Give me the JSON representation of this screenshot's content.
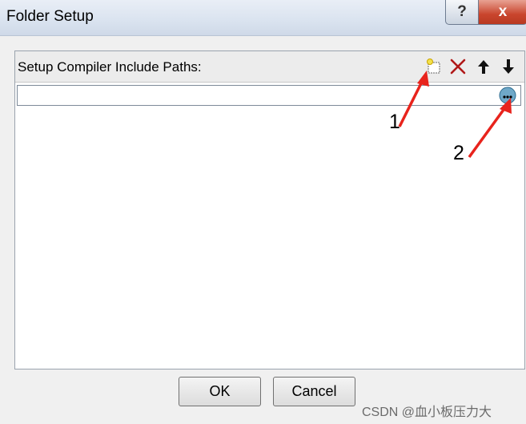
{
  "window": {
    "title": "Folder Setup",
    "help_label": "?",
    "close_label": "x"
  },
  "panel": {
    "label": "Setup Compiler Include Paths:",
    "toolbar": {
      "new_icon": "new-folder-icon",
      "delete_icon": "delete-icon",
      "move_up_icon": "arrow-up-icon",
      "move_down_icon": "arrow-down-icon"
    },
    "path_entry": {
      "value": "",
      "browse_icon": "browse-ellipsis-icon"
    }
  },
  "buttons": {
    "ok_label": "OK",
    "cancel_label": "Cancel"
  },
  "annotations": {
    "label_1": "1",
    "label_2": "2",
    "arrow_color": "#e8231c"
  },
  "watermark": "CSDN @血小板压力大"
}
